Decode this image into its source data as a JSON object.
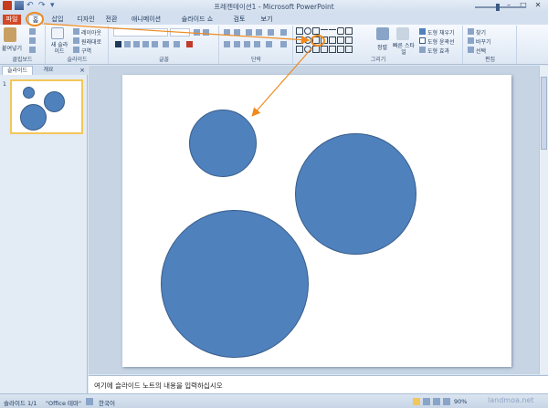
{
  "app": {
    "title": "프레젠테이션1 - Microsoft PowerPoint"
  },
  "window_controls": {
    "minimize": "–",
    "maximize": "□",
    "close": "✕"
  },
  "quick_access": {
    "undo": "↶",
    "redo": "↷",
    "more": "▾"
  },
  "tabs": [
    {
      "label": "파일"
    },
    {
      "label": "홈"
    },
    {
      "label": "삽입"
    },
    {
      "label": "디자인"
    },
    {
      "label": "전환"
    },
    {
      "label": "애니메이션"
    },
    {
      "label": "슬라이드 쇼"
    },
    {
      "label": "검토"
    },
    {
      "label": "보기"
    }
  ],
  "ribbon": {
    "clipboard": {
      "paste_label": "붙여넣기",
      "group": "클립보드"
    },
    "slides": {
      "new_label": "새 슬라이드",
      "layout": "레이아웃",
      "reset": "원래대로",
      "section": "구역",
      "group": "슬라이드"
    },
    "font": {
      "group": "글꼴"
    },
    "paragraph": {
      "group": "단락"
    },
    "drawing": {
      "arrange": "정렬",
      "quick_styles": "빠른 스타일",
      "fill": "도형 채우기",
      "outline": "도형 윤곽선",
      "effects": "도형 효과",
      "group": "그리기"
    },
    "editing": {
      "find": "찾기",
      "replace": "바꾸기",
      "select": "선택",
      "group": "편집"
    }
  },
  "left_pane": {
    "tabs": [
      {
        "label": "슬라이드"
      },
      {
        "label": "개요"
      }
    ],
    "close": "×",
    "slide_number": "1"
  },
  "notes": {
    "placeholder": "여기에 슬라이드 노트의 내용을 입력하십시오"
  },
  "status": {
    "slide": "슬라이드 1/1",
    "theme": "\"Office 테마\"",
    "language": "한국어",
    "zoom": "90%"
  },
  "watermark": "landmoa.net",
  "colors": {
    "shape_fill": "#4f81bd",
    "shape_line": "#385d8a",
    "annotation": "#ef8a1e"
  }
}
